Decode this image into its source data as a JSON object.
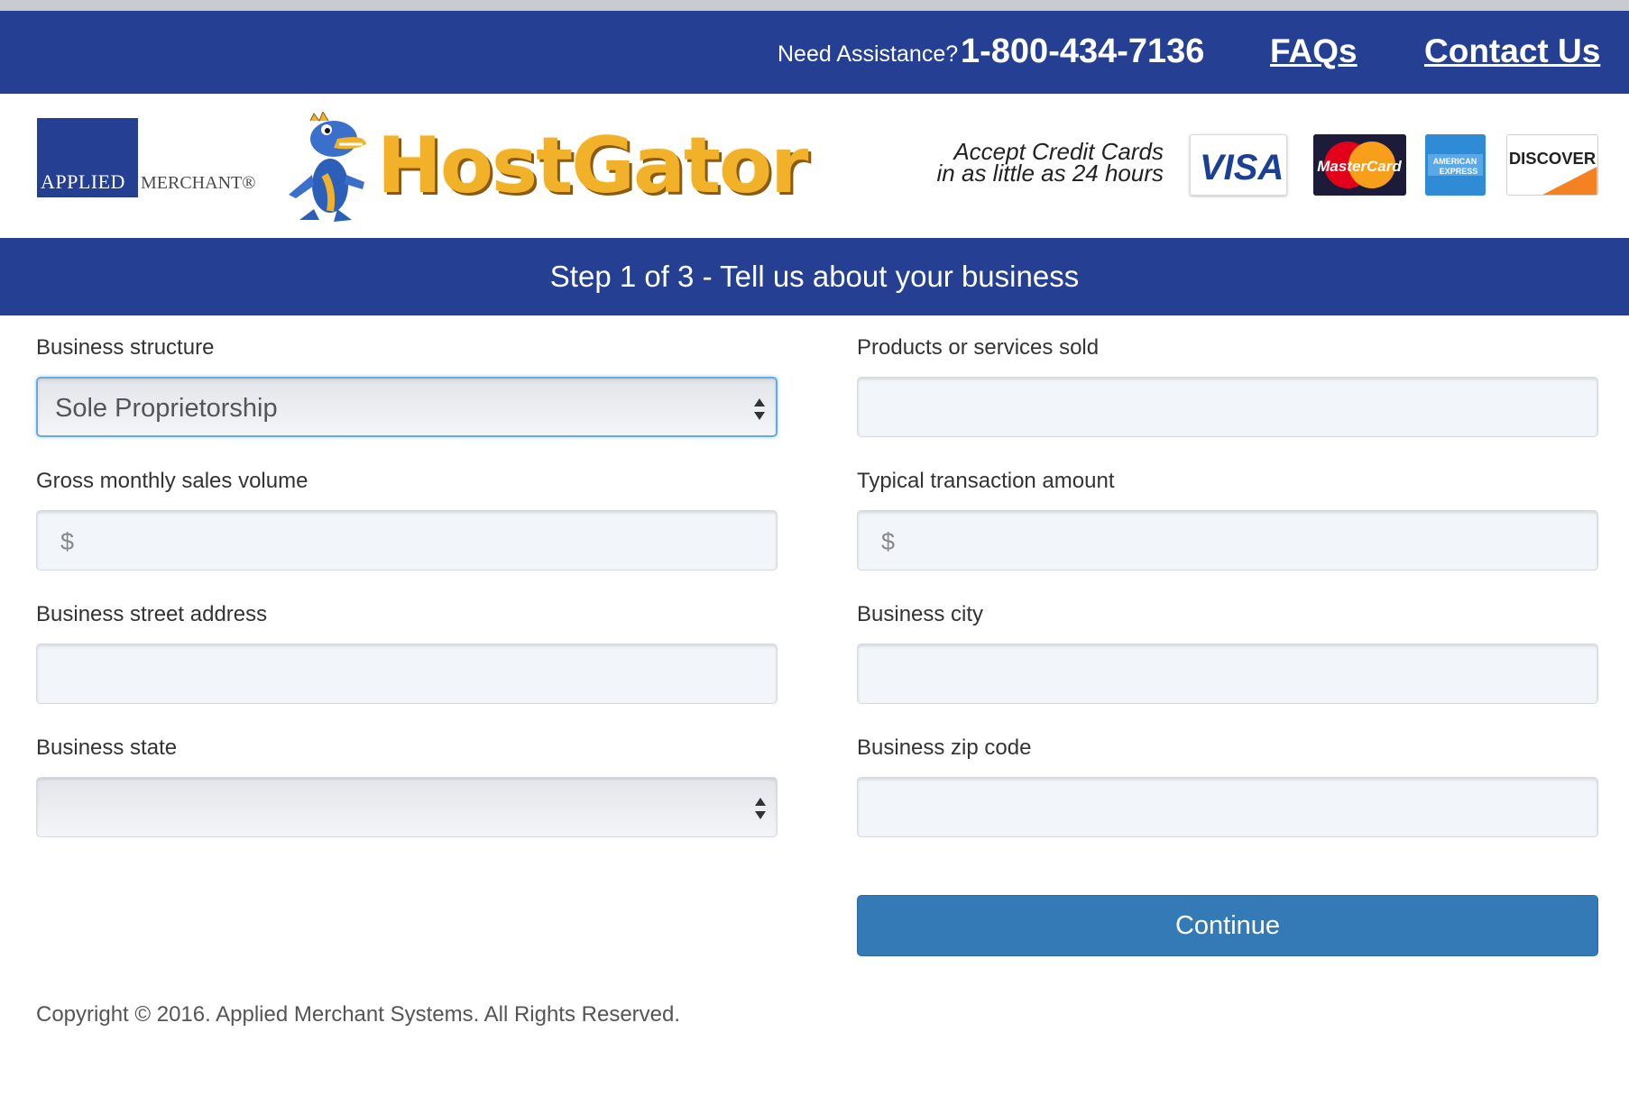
{
  "topbar": {
    "assist_label": "Need Assistance?",
    "phone": "1-800-434-7136",
    "faqs_link": "FAQs",
    "contact_link": "Contact Us"
  },
  "logos": {
    "applied_merchant": {
      "applied": "APPLIED",
      "merchant": "MERCHANT®"
    },
    "hostgator": "HostGator"
  },
  "promo": {
    "line1": "Accept Credit Cards",
    "line2": "in as little as 24 hours"
  },
  "cards": {
    "visa": "VISA",
    "mastercard": "MasterCard",
    "amex_line1": "AMERICAN",
    "amex_line2": "EXPRESS",
    "discover": "DISCOVER"
  },
  "step": {
    "title": "Step 1 of 3 - Tell us about your business"
  },
  "form": {
    "business_structure": {
      "label": "Business structure",
      "value": "Sole Proprietorship"
    },
    "products_services": {
      "label": "Products or services sold",
      "value": ""
    },
    "gross_monthly": {
      "label": "Gross monthly sales volume",
      "prefix": "$",
      "value": ""
    },
    "typical_transaction": {
      "label": "Typical transaction amount",
      "prefix": "$",
      "value": ""
    },
    "street_address": {
      "label": "Business street address",
      "value": ""
    },
    "city": {
      "label": "Business city",
      "value": ""
    },
    "state": {
      "label": "Business state",
      "value": ""
    },
    "zip": {
      "label": "Business zip code",
      "value": ""
    },
    "continue_label": "Continue"
  },
  "footer": {
    "copyright": "Copyright © 2016. Applied Merchant Systems. All Rights Reserved."
  },
  "colors": {
    "brand_blue": "#253f93",
    "button_blue": "#337ab7",
    "hostgator_orange": "#f1b128"
  }
}
